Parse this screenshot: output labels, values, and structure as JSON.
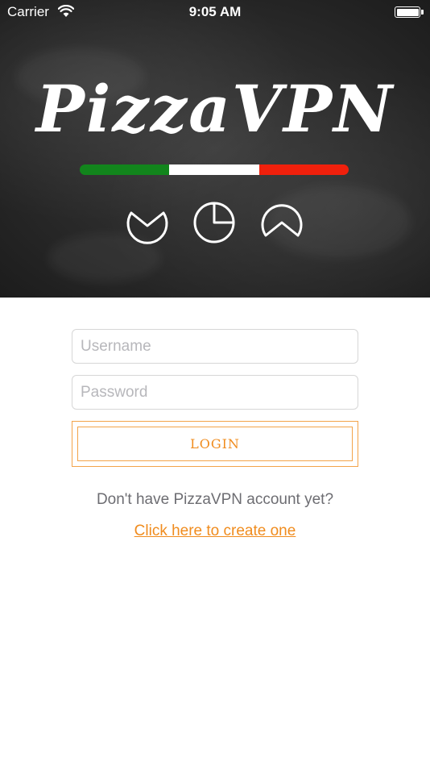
{
  "status_bar": {
    "carrier": "Carrier",
    "time": "9:05 AM"
  },
  "header": {
    "logo_text": "PizzaVPN",
    "flag_colors": [
      "#12851c",
      "#ffffff",
      "#f0200c"
    ],
    "icons": [
      "pizza-whole-bitten-icon",
      "pizza-slice-missing-icon",
      "pizza-slice-icon"
    ]
  },
  "form": {
    "username_placeholder": "Username",
    "password_placeholder": "Password",
    "login_label": "LOGIN"
  },
  "signup": {
    "prompt": "Don't have PizzaVPN account yet?",
    "link_label": "Click here to create one"
  },
  "colors": {
    "accent": "#f08c1e",
    "header_bg": "#262626"
  }
}
